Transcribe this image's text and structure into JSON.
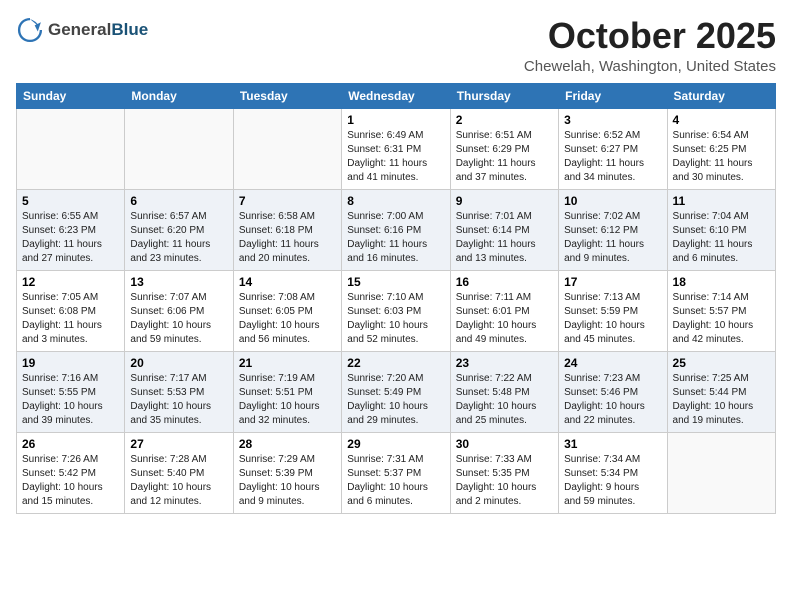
{
  "header": {
    "logo_general": "General",
    "logo_blue": "Blue",
    "month_title": "October 2025",
    "location": "Chewelah, Washington, United States"
  },
  "days_of_week": [
    "Sunday",
    "Monday",
    "Tuesday",
    "Wednesday",
    "Thursday",
    "Friday",
    "Saturday"
  ],
  "weeks": [
    [
      {
        "day": "",
        "info": ""
      },
      {
        "day": "",
        "info": ""
      },
      {
        "day": "",
        "info": ""
      },
      {
        "day": "1",
        "info": "Sunrise: 6:49 AM\nSunset: 6:31 PM\nDaylight: 11 hours\nand 41 minutes."
      },
      {
        "day": "2",
        "info": "Sunrise: 6:51 AM\nSunset: 6:29 PM\nDaylight: 11 hours\nand 37 minutes."
      },
      {
        "day": "3",
        "info": "Sunrise: 6:52 AM\nSunset: 6:27 PM\nDaylight: 11 hours\nand 34 minutes."
      },
      {
        "day": "4",
        "info": "Sunrise: 6:54 AM\nSunset: 6:25 PM\nDaylight: 11 hours\nand 30 minutes."
      }
    ],
    [
      {
        "day": "5",
        "info": "Sunrise: 6:55 AM\nSunset: 6:23 PM\nDaylight: 11 hours\nand 27 minutes."
      },
      {
        "day": "6",
        "info": "Sunrise: 6:57 AM\nSunset: 6:20 PM\nDaylight: 11 hours\nand 23 minutes."
      },
      {
        "day": "7",
        "info": "Sunrise: 6:58 AM\nSunset: 6:18 PM\nDaylight: 11 hours\nand 20 minutes."
      },
      {
        "day": "8",
        "info": "Sunrise: 7:00 AM\nSunset: 6:16 PM\nDaylight: 11 hours\nand 16 minutes."
      },
      {
        "day": "9",
        "info": "Sunrise: 7:01 AM\nSunset: 6:14 PM\nDaylight: 11 hours\nand 13 minutes."
      },
      {
        "day": "10",
        "info": "Sunrise: 7:02 AM\nSunset: 6:12 PM\nDaylight: 11 hours\nand 9 minutes."
      },
      {
        "day": "11",
        "info": "Sunrise: 7:04 AM\nSunset: 6:10 PM\nDaylight: 11 hours\nand 6 minutes."
      }
    ],
    [
      {
        "day": "12",
        "info": "Sunrise: 7:05 AM\nSunset: 6:08 PM\nDaylight: 11 hours\nand 3 minutes."
      },
      {
        "day": "13",
        "info": "Sunrise: 7:07 AM\nSunset: 6:06 PM\nDaylight: 10 hours\nand 59 minutes."
      },
      {
        "day": "14",
        "info": "Sunrise: 7:08 AM\nSunset: 6:05 PM\nDaylight: 10 hours\nand 56 minutes."
      },
      {
        "day": "15",
        "info": "Sunrise: 7:10 AM\nSunset: 6:03 PM\nDaylight: 10 hours\nand 52 minutes."
      },
      {
        "day": "16",
        "info": "Sunrise: 7:11 AM\nSunset: 6:01 PM\nDaylight: 10 hours\nand 49 minutes."
      },
      {
        "day": "17",
        "info": "Sunrise: 7:13 AM\nSunset: 5:59 PM\nDaylight: 10 hours\nand 45 minutes."
      },
      {
        "day": "18",
        "info": "Sunrise: 7:14 AM\nSunset: 5:57 PM\nDaylight: 10 hours\nand 42 minutes."
      }
    ],
    [
      {
        "day": "19",
        "info": "Sunrise: 7:16 AM\nSunset: 5:55 PM\nDaylight: 10 hours\nand 39 minutes."
      },
      {
        "day": "20",
        "info": "Sunrise: 7:17 AM\nSunset: 5:53 PM\nDaylight: 10 hours\nand 35 minutes."
      },
      {
        "day": "21",
        "info": "Sunrise: 7:19 AM\nSunset: 5:51 PM\nDaylight: 10 hours\nand 32 minutes."
      },
      {
        "day": "22",
        "info": "Sunrise: 7:20 AM\nSunset: 5:49 PM\nDaylight: 10 hours\nand 29 minutes."
      },
      {
        "day": "23",
        "info": "Sunrise: 7:22 AM\nSunset: 5:48 PM\nDaylight: 10 hours\nand 25 minutes."
      },
      {
        "day": "24",
        "info": "Sunrise: 7:23 AM\nSunset: 5:46 PM\nDaylight: 10 hours\nand 22 minutes."
      },
      {
        "day": "25",
        "info": "Sunrise: 7:25 AM\nSunset: 5:44 PM\nDaylight: 10 hours\nand 19 minutes."
      }
    ],
    [
      {
        "day": "26",
        "info": "Sunrise: 7:26 AM\nSunset: 5:42 PM\nDaylight: 10 hours\nand 15 minutes."
      },
      {
        "day": "27",
        "info": "Sunrise: 7:28 AM\nSunset: 5:40 PM\nDaylight: 10 hours\nand 12 minutes."
      },
      {
        "day": "28",
        "info": "Sunrise: 7:29 AM\nSunset: 5:39 PM\nDaylight: 10 hours\nand 9 minutes."
      },
      {
        "day": "29",
        "info": "Sunrise: 7:31 AM\nSunset: 5:37 PM\nDaylight: 10 hours\nand 6 minutes."
      },
      {
        "day": "30",
        "info": "Sunrise: 7:33 AM\nSunset: 5:35 PM\nDaylight: 10 hours\nand 2 minutes."
      },
      {
        "day": "31",
        "info": "Sunrise: 7:34 AM\nSunset: 5:34 PM\nDaylight: 9 hours\nand 59 minutes."
      },
      {
        "day": "",
        "info": ""
      }
    ]
  ]
}
